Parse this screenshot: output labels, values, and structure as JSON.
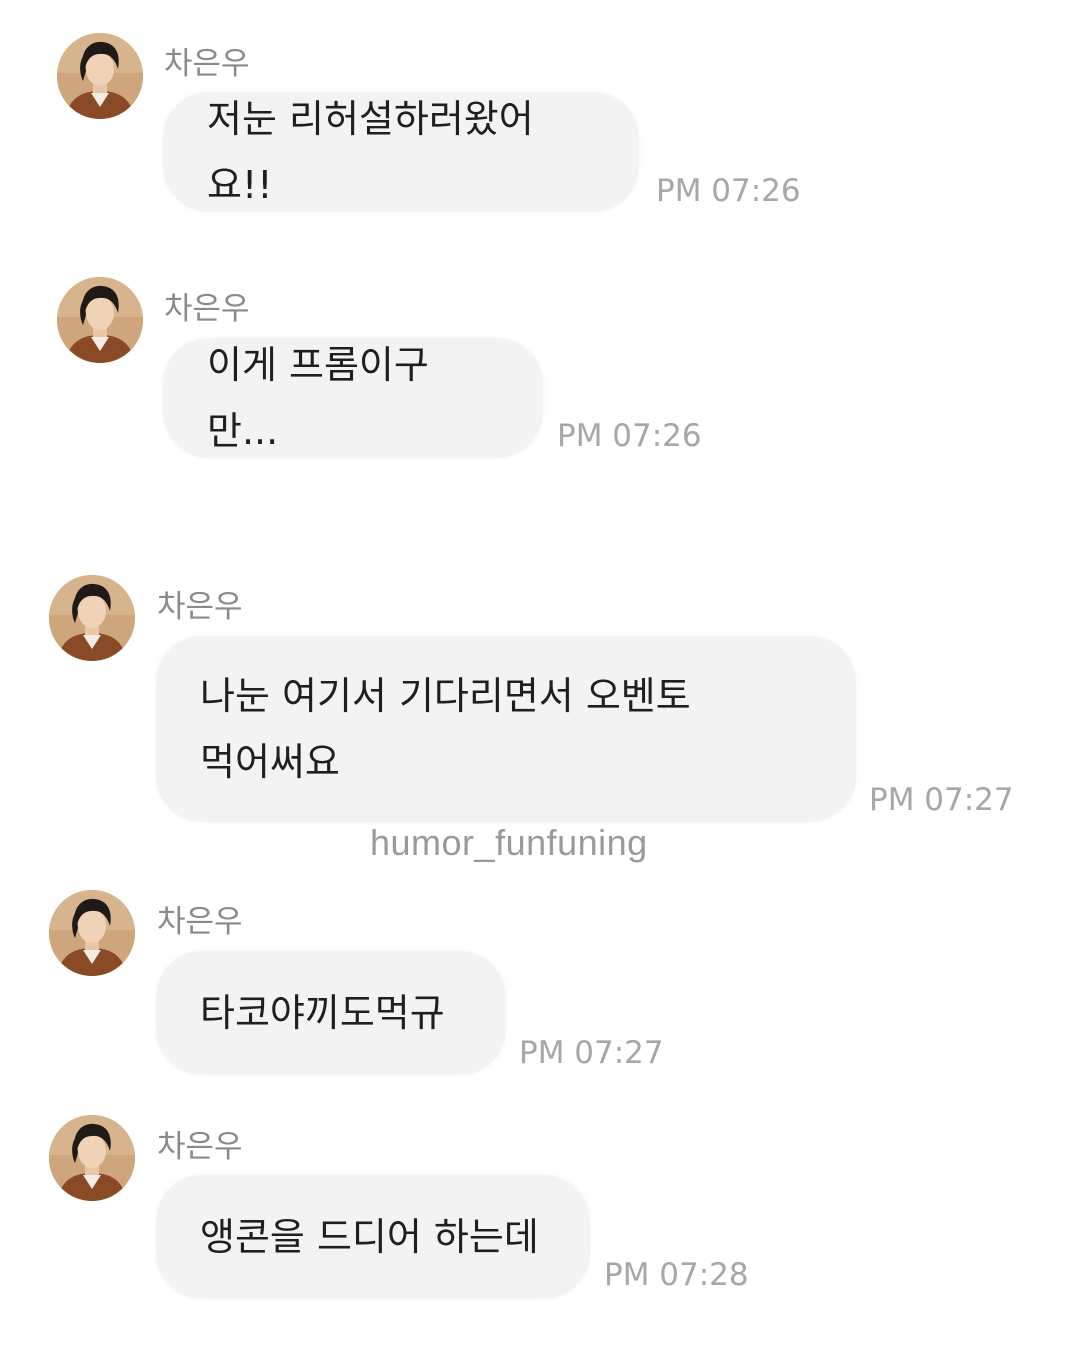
{
  "sender_name": "차은우",
  "messages": [
    {
      "text": "저눈 리허설하러왔어요!!",
      "time": "PM 07:26"
    },
    {
      "text": "이게 프롬이구만...",
      "time": "PM 07:26"
    },
    {
      "text": "나눈 여기서 기다리면서 오벤토\n먹어써요",
      "time": "PM 07:27"
    },
    {
      "text": "타코야끼도먹규",
      "time": "PM 07:27"
    },
    {
      "text": "앵콘을 드디어 하는데",
      "time": "PM 07:28"
    }
  ],
  "watermark": "humor_funfuning",
  "colors": {
    "bubble": "#f3f3f4",
    "time": "#a7a7a7",
    "sender": "#8a8a8a"
  }
}
